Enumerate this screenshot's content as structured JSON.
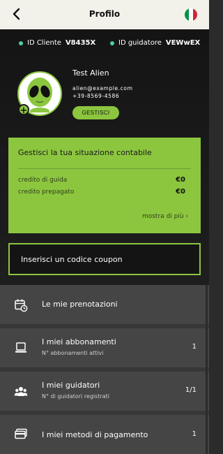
{
  "header": {
    "title": "Profilo",
    "back_icon": "arrow-left-icon",
    "flag_icon": "italy-flag-icon",
    "flag_colors": [
      "#009246",
      "#ffffff",
      "#ce2b37"
    ]
  },
  "ids": {
    "client_label": "ID Cliente",
    "client_value": "V8435X",
    "driver_label": "ID guidatore",
    "driver_value": "VEWwEX",
    "dot_color": "#4ed09a"
  },
  "profile": {
    "name": "Test Alien",
    "email": "alien@example.com",
    "phone": "+39-8569-4586",
    "manage_label": "GESTISCI",
    "avatar_icon": "alien-avatar-icon",
    "add_icon": "plus-icon"
  },
  "account": {
    "title": "Gestisci la tua situazione contabile",
    "rows": [
      {
        "label": "credito di guida",
        "value": "€0"
      },
      {
        "label": "credito prepagato",
        "value": "€0"
      }
    ],
    "more_label": "mostra di più ›",
    "accent_color": "#8cc63f"
  },
  "coupon": {
    "label": "Inserisci un codice coupon"
  },
  "menu": {
    "items": [
      {
        "label": "Le mie prenotazioni",
        "sub": "",
        "value": "",
        "icon": "calendar-clock-icon"
      },
      {
        "label": "I miei abbonamenti",
        "sub": "N° abbonamenti attivi",
        "value": "1",
        "icon": "laptop-icon"
      },
      {
        "label": "I miei guidatori",
        "sub": "N° di guidatori registrati",
        "value": "1/1",
        "icon": "people-icon"
      },
      {
        "label": "I miei metodi di pagamento",
        "sub": "",
        "value": "1",
        "icon": "credit-card-icon"
      }
    ]
  }
}
